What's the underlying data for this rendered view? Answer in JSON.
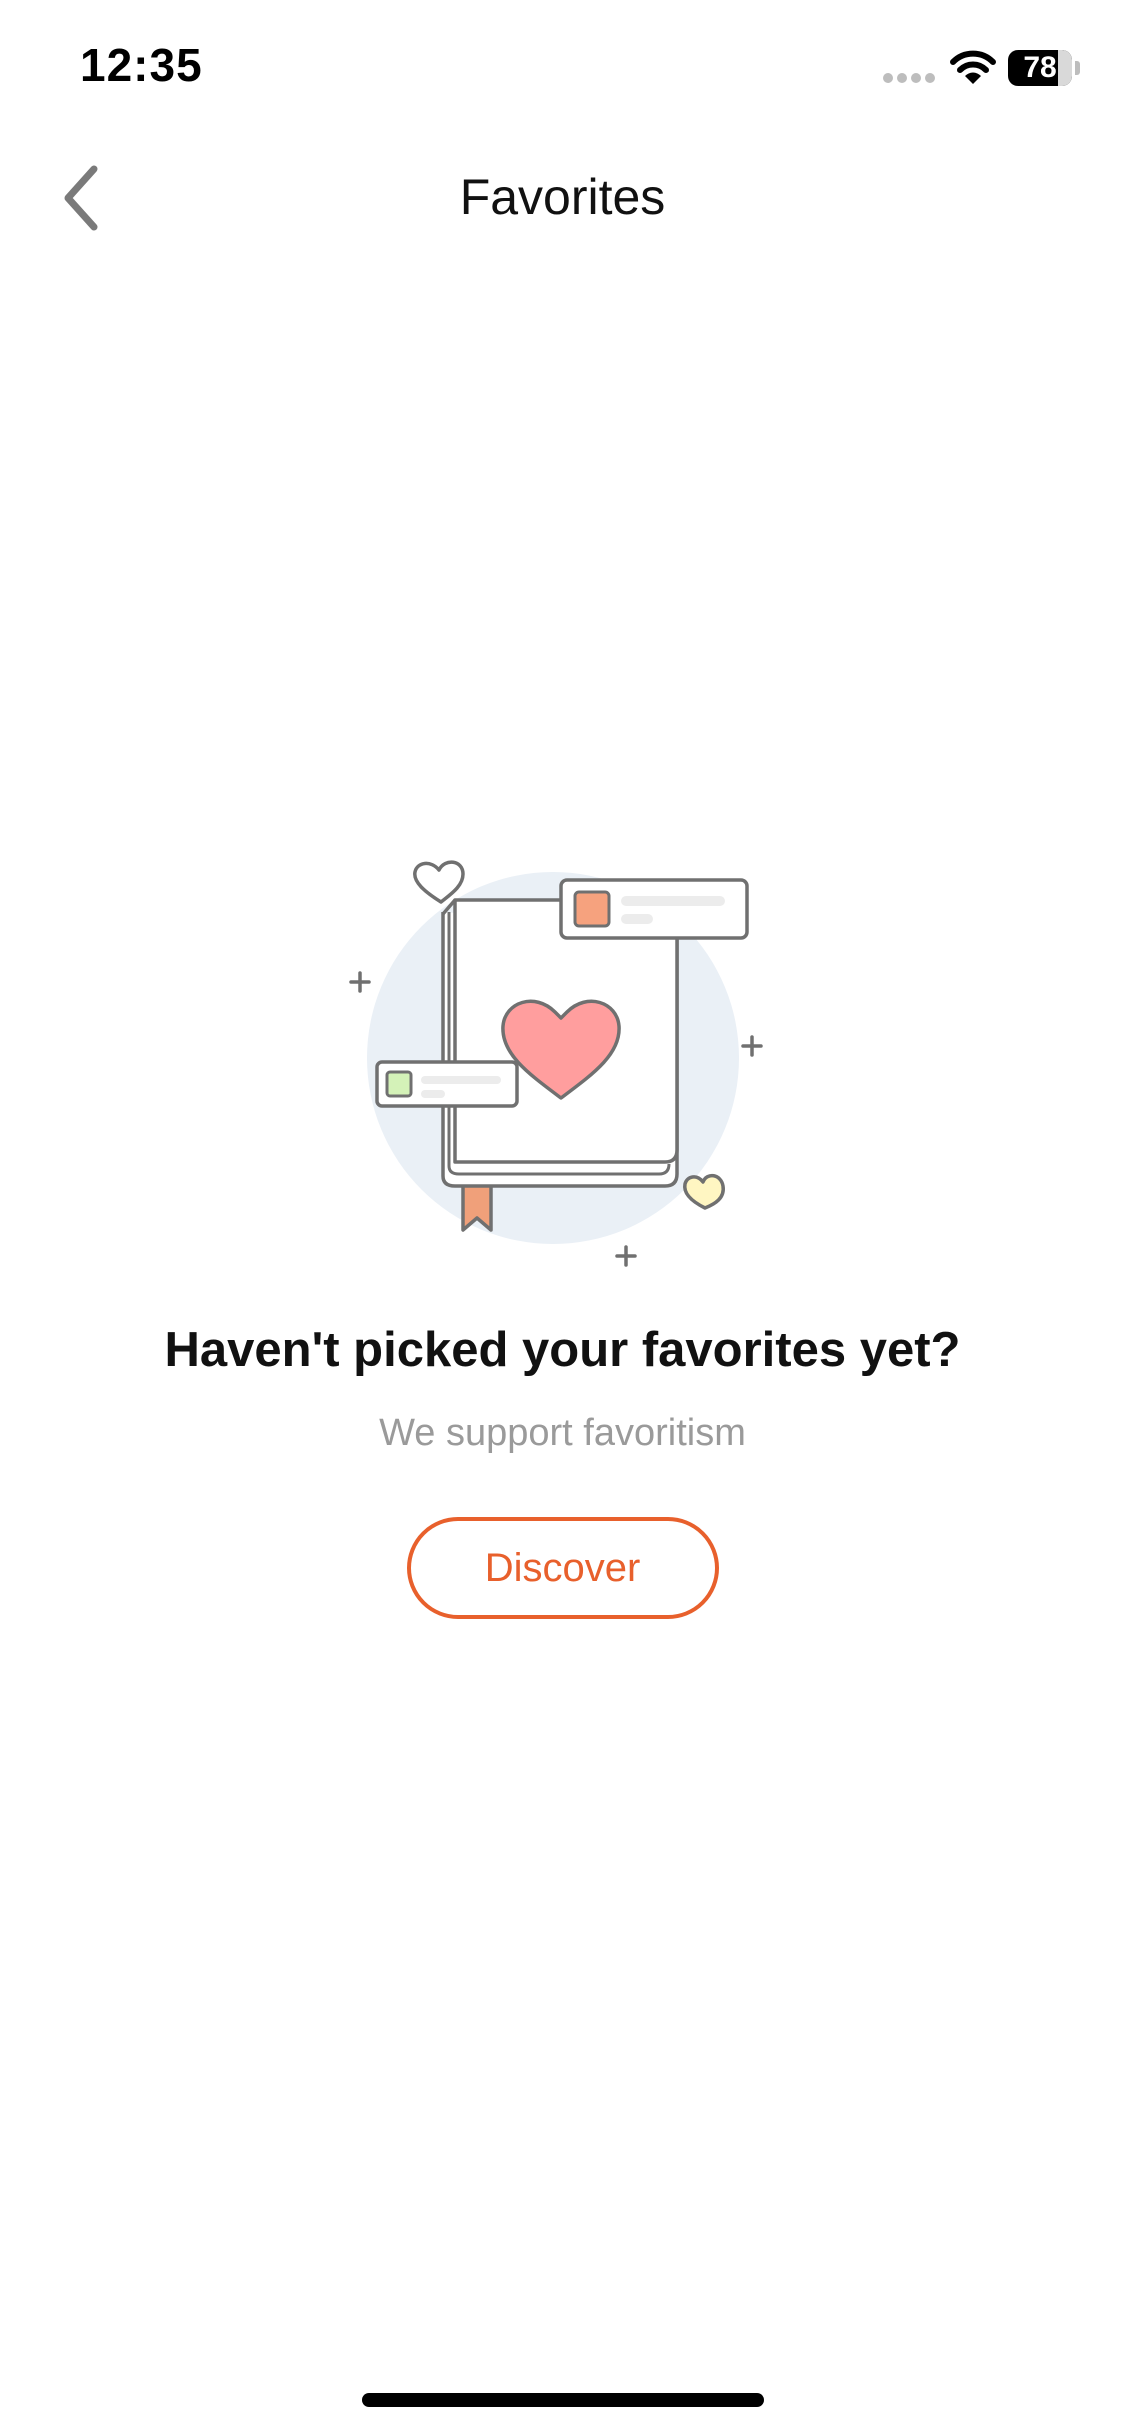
{
  "status_bar": {
    "time": "12:35",
    "battery_text": "78",
    "battery_level": 0.78,
    "icons": [
      "signal-icon",
      "wifi-icon",
      "battery-icon"
    ]
  },
  "nav": {
    "title": "Favorites",
    "back_icon": "chevron-left-icon"
  },
  "empty_state": {
    "illustration": "book-with-heart-illustration",
    "title": "Haven't picked your favorites yet?",
    "subtitle": "We support favoritism",
    "button_label": "Discover"
  },
  "colors": {
    "accent": "#e8602c",
    "heart": "#ff9e9e",
    "circle_bg": "#eaf0f6",
    "subtitle": "#9a9a9a"
  }
}
